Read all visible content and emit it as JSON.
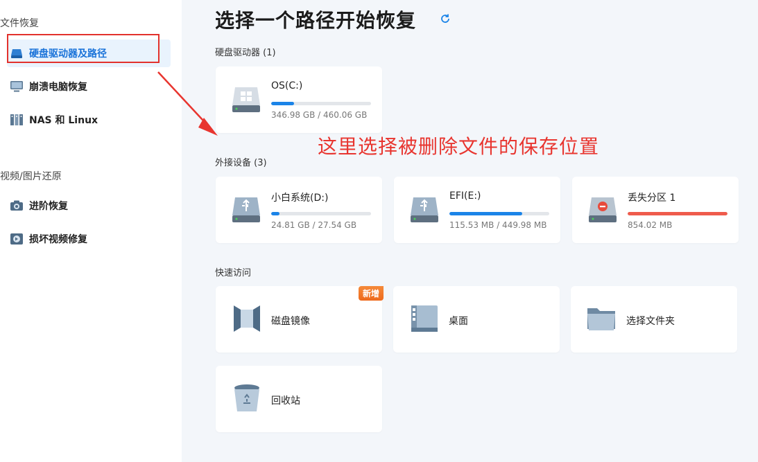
{
  "sidebar": {
    "section_file": "文件恢复",
    "section_video": "视频/图片还原",
    "items": [
      {
        "label": "硬盘驱动器及路径",
        "icon": "drive-icon"
      },
      {
        "label": "崩溃电脑恢复",
        "icon": "monitor-icon"
      },
      {
        "label": "NAS 和 Linux",
        "icon": "nas-icon"
      },
      {
        "label": "进阶恢复",
        "icon": "camera-icon"
      },
      {
        "label": "损坏视频修复",
        "icon": "video-repair-icon"
      }
    ]
  },
  "main": {
    "title": "选择一个路径开始恢复",
    "hdd_group": "硬盘驱动器",
    "hdd_count": "(1)",
    "ext_group": "外接设备",
    "ext_count": "(3)",
    "quick_group": "快速访问",
    "annotation": "这里选择被删除文件的保存位置",
    "drives": [
      {
        "name": "OS(C:)",
        "size": "346.98 GB / 460.06 GB",
        "usage": 0.23,
        "icon": "windows-drive-icon"
      }
    ],
    "external": [
      {
        "name": "小白系统(D:)",
        "size": "24.81 GB / 27.54 GB",
        "usage": 0.08,
        "icon": "usb-drive-icon"
      },
      {
        "name": "EFI(E:)",
        "size": "115.53 MB / 449.98 MB",
        "usage": 0.73,
        "icon": "usb-drive-icon"
      },
      {
        "name": "丢失分区 1",
        "size": "854.02 MB",
        "usage": 1.0,
        "icon": "lost-partition-icon"
      }
    ],
    "quick": [
      {
        "name": "磁盘镜像",
        "badge": "新增",
        "icon": "disk-image-icon"
      },
      {
        "name": "桌面",
        "icon": "desktop-icon"
      },
      {
        "name": "选择文件夹",
        "icon": "folder-icon"
      },
      {
        "name": "回收站",
        "icon": "recycle-bin-icon"
      }
    ]
  },
  "colors": {
    "accent": "#1b84e8",
    "annotation": "#e8352f",
    "lost": "#ef5b4c",
    "badge": "#f07a28"
  }
}
